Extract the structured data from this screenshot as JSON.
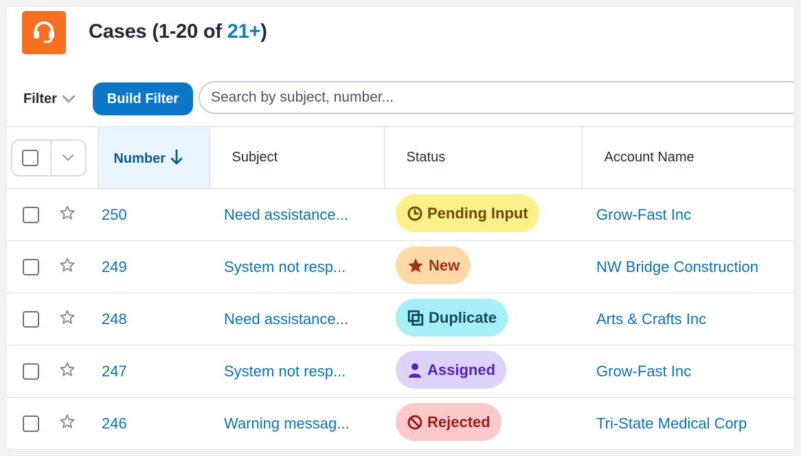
{
  "header": {
    "title_prefix": "Cases (1-20 of ",
    "title_count": "21+",
    "title_suffix": ")",
    "app_icon": "headset-icon",
    "app_icon_color": "#f7701f"
  },
  "toolbar": {
    "filter_label": "Filter",
    "build_filter_label": "Build Filter",
    "search_placeholder": "Search by subject, number..."
  },
  "columns": {
    "number": "Number",
    "subject": "Subject",
    "status": "Status",
    "account": "Account Name"
  },
  "rows": [
    {
      "number": "250",
      "subject": "Need assistance...",
      "status": "Pending Input",
      "status_icon": "clock-icon",
      "status_bg": "#fbf08a",
      "status_fg": "#6b4a05",
      "account": "Grow-Fast Inc"
    },
    {
      "number": "249",
      "subject": "System not resp...",
      "status": "New",
      "status_icon": "star-icon",
      "status_bg": "#fdd9a8",
      "status_fg": "#9a3412",
      "account": "NW Bridge Construction"
    },
    {
      "number": "248",
      "subject": "Need assistance...",
      "status": "Duplicate",
      "status_icon": "copy-icon",
      "status_bg": "#a6eef8",
      "status_fg": "#0f4a5e",
      "account": "Arts & Crafts Inc"
    },
    {
      "number": "247",
      "subject": "System not resp...",
      "status": "Assigned",
      "status_icon": "person-icon",
      "status_bg": "#ddd3f9",
      "status_fg": "#5b21b6",
      "account": "Grow-Fast Inc"
    },
    {
      "number": "246",
      "subject": "Warning messag...",
      "status": "Rejected",
      "status_icon": "prohibited-icon",
      "status_bg": "#fcc9cb",
      "status_fg": "#9b1c1c",
      "account": "Tri-State Medical Corp"
    }
  ],
  "colors": {
    "accent": "#0d77c7",
    "link": "#0b72b5",
    "sorted_header_bg": "#eaf5fd"
  }
}
